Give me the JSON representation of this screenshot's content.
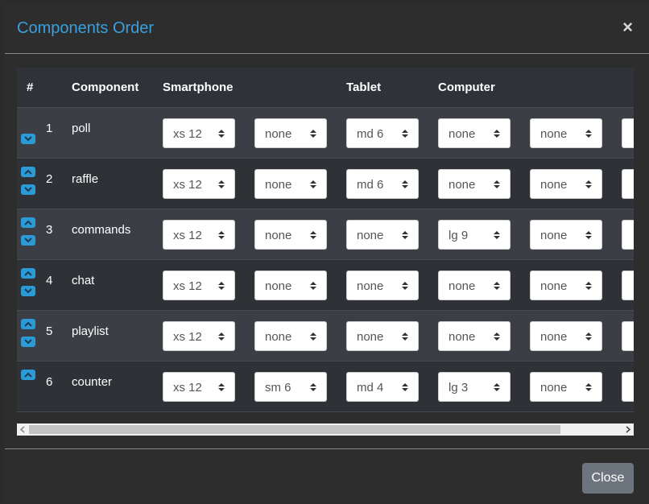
{
  "modal": {
    "title": "Components Order",
    "close_symbol": "×",
    "close_label": "Close"
  },
  "table": {
    "headers": [
      "#",
      "Component",
      "Smartphone",
      "Tablet",
      "Computer"
    ],
    "rows": [
      {
        "num": "1",
        "name": "poll",
        "up": false,
        "down": true,
        "sizes": [
          "xs 12",
          "none",
          "md 6",
          "none",
          "none"
        ]
      },
      {
        "num": "2",
        "name": "raffle",
        "up": true,
        "down": true,
        "sizes": [
          "xs 12",
          "none",
          "md 6",
          "none",
          "none"
        ]
      },
      {
        "num": "3",
        "name": "commands",
        "up": true,
        "down": true,
        "sizes": [
          "xs 12",
          "none",
          "none",
          "lg 9",
          "none"
        ]
      },
      {
        "num": "4",
        "name": "chat",
        "up": true,
        "down": true,
        "sizes": [
          "xs 12",
          "none",
          "none",
          "none",
          "none"
        ]
      },
      {
        "num": "5",
        "name": "playlist",
        "up": true,
        "down": true,
        "sizes": [
          "xs 12",
          "none",
          "none",
          "none",
          "none"
        ]
      },
      {
        "num": "6",
        "name": "counter",
        "up": true,
        "down": false,
        "sizes": [
          "xs 12",
          "sm 6",
          "md 4",
          "lg 3",
          "none"
        ]
      }
    ]
  },
  "colors": {
    "title": "#3aa0dc",
    "arrow_button": "#2b9ad7",
    "close_button": "#6c757d"
  },
  "icons": {
    "up": "chevron-up-icon",
    "down": "chevron-down-icon",
    "select_caret": "sort-caret-icon",
    "close": "close-icon"
  }
}
